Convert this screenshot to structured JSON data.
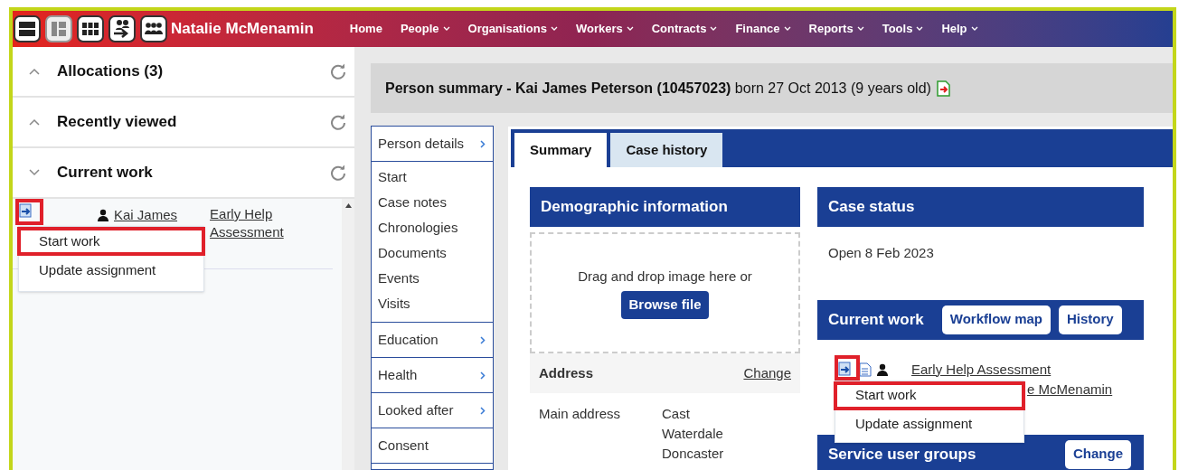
{
  "header": {
    "view_buttons": [
      {
        "kind": "rows",
        "selected": false
      },
      {
        "kind": "tiles",
        "selected": true
      },
      {
        "kind": "grid",
        "selected": false
      },
      {
        "kind": "person-arrow",
        "selected": false
      },
      {
        "kind": "group",
        "selected": false
      }
    ],
    "user_name": "Natalie McMenamin",
    "nav": [
      {
        "label": "Home",
        "has_menu": false
      },
      {
        "label": "People",
        "has_menu": true
      },
      {
        "label": "Organisations",
        "has_menu": true
      },
      {
        "label": "Workers",
        "has_menu": true
      },
      {
        "label": "Contracts",
        "has_menu": true
      },
      {
        "label": "Finance",
        "has_menu": true
      },
      {
        "label": "Reports",
        "has_menu": true
      },
      {
        "label": "Tools",
        "has_menu": true
      },
      {
        "label": "Help",
        "has_menu": true
      }
    ]
  },
  "sidebar": {
    "sections": [
      {
        "title": "Allocations (3)",
        "expanded": false
      },
      {
        "title": "Recently viewed",
        "expanded": false
      },
      {
        "title": "Current work",
        "expanded": true
      }
    ],
    "work_item": {
      "person": "Kai James",
      "link": "Early Help Assessment",
      "menu": [
        {
          "label": "Start work",
          "highlighted": true
        },
        {
          "label": "Update assignment",
          "highlighted": false
        }
      ]
    }
  },
  "summary": {
    "text": "**Person summary - Kai James Peterson (10457023)** born 27 Oct 2013 (9 years old)"
  },
  "side_nav": [
    {
      "title": "Person details",
      "has_children": true,
      "items": [
        "Start",
        "Case notes",
        "Chronologies",
        "Documents",
        "Events",
        "Visits"
      ]
    },
    {
      "title": "Education",
      "has_children": true
    },
    {
      "title": "Health",
      "has_children": true
    },
    {
      "title": "Looked after",
      "has_children": true
    },
    {
      "title": "Consent",
      "has_children": false
    }
  ],
  "tabs": [
    {
      "label": "Summary",
      "selected": true
    },
    {
      "label": "Case history",
      "selected": false
    }
  ],
  "demographic": {
    "title": "Demographic information",
    "drop_text": "Drag and drop image here or",
    "browse_button": "Browse file",
    "address_label": "Address",
    "change_link": "Change",
    "main_address_label": "Main address",
    "address_lines": [
      "Cast",
      "Waterdale",
      "Doncaster"
    ]
  },
  "case_status": {
    "title": "Case status",
    "text": "Open 8 Feb 2023"
  },
  "current_work": {
    "title": "Current work",
    "buttons": [
      "Workflow map",
      "History"
    ],
    "link": "Early Help Assessment",
    "second_line": "e McMenamin",
    "menu": [
      {
        "label": "Start work",
        "highlighted": true
      },
      {
        "label": "Update assignment",
        "highlighted": false
      }
    ]
  },
  "service_user_groups": {
    "title": "Service user groups",
    "button": "Change"
  }
}
